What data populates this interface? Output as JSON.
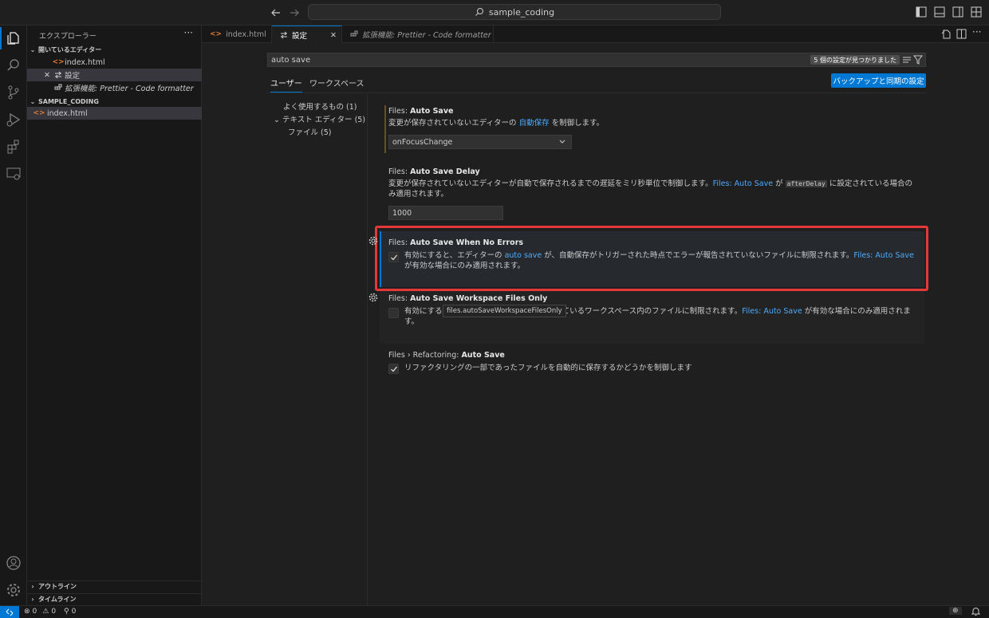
{
  "titlebar": {
    "search_label": "sample_coding"
  },
  "sidebar": {
    "title": "エクスプローラー",
    "more": "···",
    "open_editors_header": "開いているエディター",
    "open_editors": [
      {
        "label": "index.html"
      },
      {
        "label": "設定"
      },
      {
        "label": "拡張機能: Prettier - Code formatter"
      }
    ],
    "folder_header": "SAMPLE_CODING",
    "files": [
      {
        "label": "index.html"
      }
    ],
    "outline_header": "アウトライン",
    "timeline_header": "タイムライン"
  },
  "tabs": [
    {
      "label": "index.html"
    },
    {
      "label": "設定"
    },
    {
      "label": "拡張機能: Prettier - Code formatter"
    }
  ],
  "settings": {
    "search_value": "auto save",
    "found_badge": "5 個の設定が見つかりました",
    "scope_user": "ユーザー",
    "scope_workspace": "ワークスペース",
    "sync_button": "バックアップと同期の設定",
    "toc": [
      {
        "label": "よく使用するもの (1)"
      },
      {
        "label": "テキスト エディター (5)"
      },
      {
        "label": "ファイル (5)"
      }
    ],
    "items": [
      {
        "category": "Files: ",
        "name": "Auto Save",
        "desc_pre": "変更が保存されていないエディターの ",
        "desc_link": "自動保存",
        "desc_post": " を制御します。",
        "value": "onFocusChange"
      },
      {
        "category": "Files: ",
        "name": "Auto Save Delay",
        "desc_pre": "変更が保存されていないエディターが自動で保存されるまでの遅延をミリ秒単位で制御します。",
        "desc_link": "Files: Auto Save",
        "desc_mid": " が ",
        "desc_code": "afterDelay",
        "desc_post": " に設定されている場合のみ適用されます。",
        "value": "1000"
      },
      {
        "category": "Files: ",
        "name": "Auto Save When No Errors",
        "desc_pre": "有効にすると、エディターの ",
        "desc_link": "auto save",
        "desc_mid": " が、自動保存がトリガーされた時点でエラーが報告されていないファイルに制限されます。",
        "desc_link2": "Files: Auto Save",
        "desc_post": " が有効な場合にのみ適用されます。",
        "checked": true
      },
      {
        "category": "Files: ",
        "name": "Auto Save Workspace Files Only",
        "desc_pre": "有効にする",
        "desc_mid": "ているワークスペース内のファイルに制限されます。",
        "desc_link": "Files: Auto Save",
        "desc_post": " が有効な場合にのみ適用されます。",
        "tooltip": "files.autoSaveWorkspaceFilesOnly",
        "checked": false
      },
      {
        "category": "Files › Refactoring: ",
        "name": "Auto Save",
        "desc_pre": "リファクタリングの一部であったファイルを自動的に保存するかどうかを制御します",
        "checked": true
      }
    ]
  },
  "statusbar": {
    "errors": "0",
    "warnings": "0",
    "ports": "0"
  },
  "colors": {
    "accent": "#0078d4",
    "highlight_border": "#e5383b",
    "link": "#4daafc"
  }
}
